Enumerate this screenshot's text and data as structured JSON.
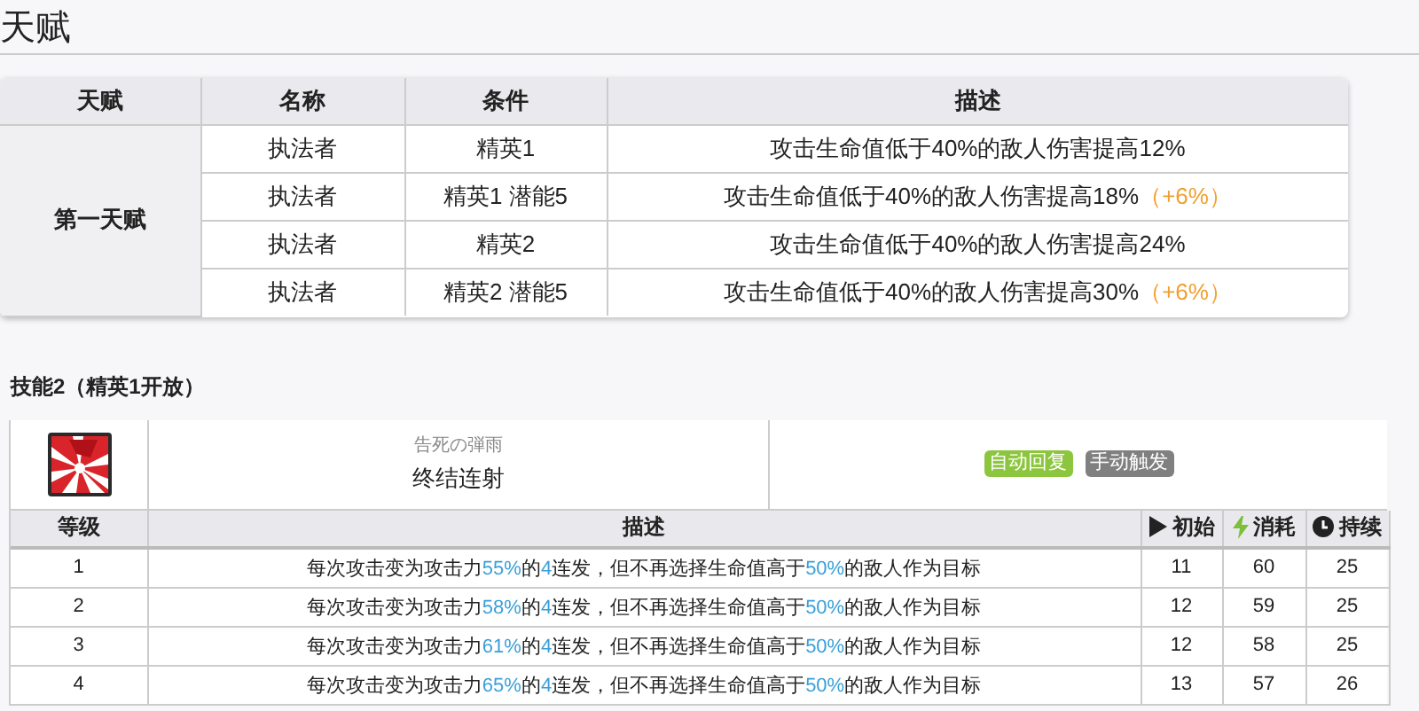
{
  "talent_section": {
    "title": "天赋",
    "columns": [
      "天赋",
      "名称",
      "条件",
      "描述"
    ],
    "group": "第一天赋",
    "rows": [
      {
        "name": "执法者",
        "condition": "精英1",
        "description": "攻击生命值低于40%的敌人伤害提高12%"
      },
      {
        "name": "执法者",
        "condition": "精英1 潜能5",
        "description": "攻击生命值低于40%的敌人伤害提高18%",
        "bonus": "（+6%）"
      },
      {
        "name": "执法者",
        "condition": "精英2",
        "description": "攻击生命值低于40%的敌人伤害提高24%"
      },
      {
        "name": "执法者",
        "condition": "精英2 潜能5",
        "description": "攻击生命值低于40%的敌人伤害提高30%",
        "bonus": "（+6%）"
      }
    ]
  },
  "skill_section": {
    "title": "技能2（精英1开放）",
    "skill_subtitle": "告死の弾雨",
    "skill_name": "终结连射",
    "tags": [
      {
        "label": "自动回复",
        "color": "#8cc63f"
      },
      {
        "label": "手动触发",
        "color": "#808080"
      }
    ],
    "columns": [
      "等级",
      "描述",
      "初始",
      "消耗",
      "持续"
    ],
    "rows": [
      {
        "level": "1",
        "description": [
          {
            "text": "每次攻击变为攻击力",
            "accent": false
          },
          {
            "text": "55%",
            "accent": true
          },
          {
            "text": "的",
            "accent": false
          },
          {
            "text": "4",
            "accent": true
          },
          {
            "text": "连发，但不再选择生命值高于",
            "accent": false
          },
          {
            "text": "50%",
            "accent": true
          },
          {
            "text": "的敌人作为目标",
            "accent": false
          }
        ],
        "initial": "11",
        "cost": "60",
        "duration": "25"
      },
      {
        "level": "2",
        "description": [
          {
            "text": "每次攻击变为攻击力",
            "accent": false
          },
          {
            "text": "58%",
            "accent": true
          },
          {
            "text": "的",
            "accent": false
          },
          {
            "text": "4",
            "accent": true
          },
          {
            "text": "连发，但不再选择生命值高于",
            "accent": false
          },
          {
            "text": "50%",
            "accent": true
          },
          {
            "text": "的敌人作为目标",
            "accent": false
          }
        ],
        "initial": "12",
        "cost": "59",
        "duration": "25"
      },
      {
        "level": "3",
        "description": [
          {
            "text": "每次攻击变为攻击力",
            "accent": false
          },
          {
            "text": "61%",
            "accent": true
          },
          {
            "text": "的",
            "accent": false
          },
          {
            "text": "4",
            "accent": true
          },
          {
            "text": "连发，但不再选择生命值高于",
            "accent": false
          },
          {
            "text": "50%",
            "accent": true
          },
          {
            "text": "的敌人作为目标",
            "accent": false
          }
        ],
        "initial": "12",
        "cost": "58",
        "duration": "25"
      },
      {
        "level": "4",
        "description": [
          {
            "text": "每次攻击变为攻击力",
            "accent": false
          },
          {
            "text": "65%",
            "accent": true
          },
          {
            "text": "的",
            "accent": false
          },
          {
            "text": "4",
            "accent": true
          },
          {
            "text": "连发，但不再选择生命值高于",
            "accent": false
          },
          {
            "text": "50%",
            "accent": true
          },
          {
            "text": "的敌人作为目标",
            "accent": false
          }
        ],
        "initial": "13",
        "cost": "57",
        "duration": "26"
      }
    ]
  }
}
